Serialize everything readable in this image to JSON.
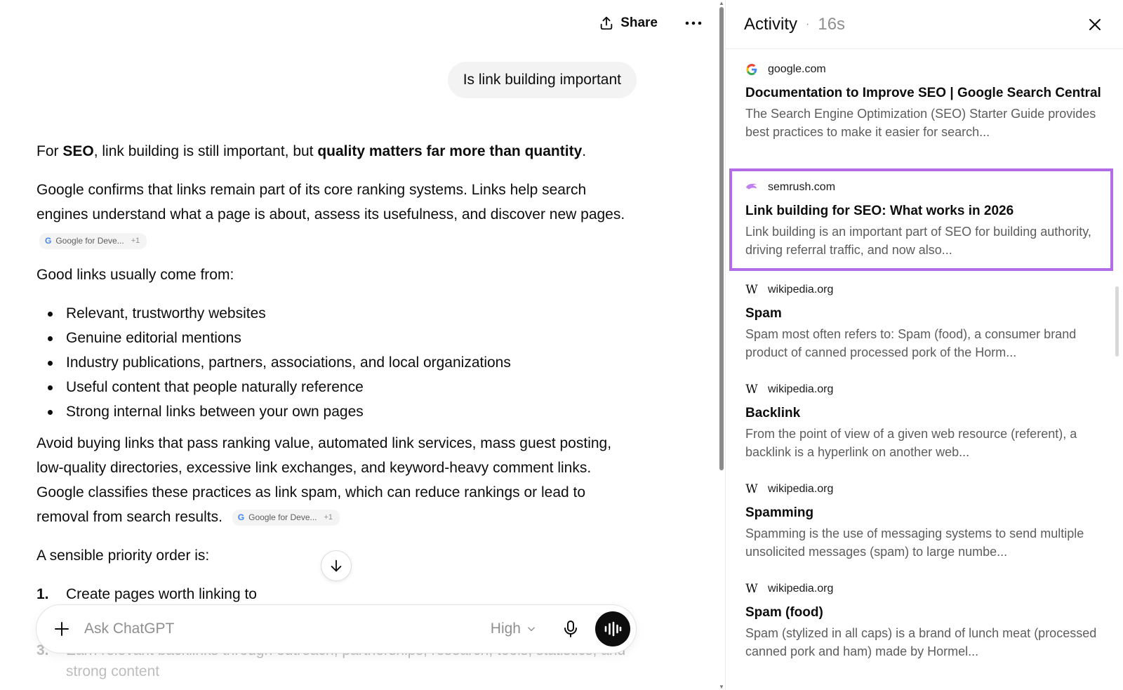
{
  "header": {
    "share_label": "Share",
    "more_icon": "more-horizontal-icon"
  },
  "user_message": "Is link building important",
  "answer": {
    "p1_pre": "For ",
    "p1_b1": "SEO",
    "p1_mid": ", link building is still important, but ",
    "p1_b2": "quality matters far more than quantity",
    "p1_post": ".",
    "p2": "Google confirms that links remain part of its core ranking systems. Links help search engines understand what a page is about, assess its usefulness, and discover new pages.",
    "citation_1": {
      "label": "Google for Deve...",
      "more": "+1"
    },
    "p3": "Good links usually come from:",
    "bullets": [
      "Relevant, trustworthy websites",
      "Genuine editorial mentions",
      "Industry publications, partners, associations, and local organizations",
      "Useful content that people naturally reference",
      "Strong internal links between your own pages"
    ],
    "p4": "Avoid buying links that pass ranking value, automated link services, mass guest posting, low-quality directories, excessive link exchanges, and keyword-heavy comment links. Google classifies these practices as link spam, which can reduce rankings or lead to removal from search results.",
    "citation_2": {
      "label": "Google for Deve...",
      "more": "+1"
    },
    "p5": "A sensible priority order is:",
    "steps": [
      {
        "num": "1.",
        "text": "Create pages worth linking to"
      },
      {
        "num": "3.",
        "text": "Earn relevant backlinks through outreach, partnerships, research, tools, statistics, and"
      },
      {
        "num": "",
        "text": "strong content"
      }
    ]
  },
  "composer": {
    "placeholder": "Ask ChatGPT",
    "model_label": "High"
  },
  "activity": {
    "title": "Activity",
    "elapsed": "16s",
    "sources": [
      {
        "domain": "google.com",
        "icon": "google-icon",
        "title": "Documentation to Improve SEO | Google Search Central",
        "snippet": "The Search Engine Optimization (SEO) Starter Guide provides best practices to make it easier for search..."
      },
      {
        "domain": "semrush.com",
        "icon": "semrush-icon",
        "title": "Link building for SEO: What works in 2026",
        "snippet": "Link building is an important part of SEO for building authority, driving referral traffic, and now also..."
      },
      {
        "domain": "wikipedia.org",
        "icon": "wikipedia-icon",
        "title": "Spam",
        "snippet": "Spam most often refers to: Spam (food), a consumer brand product of canned processed pork of the Horm..."
      },
      {
        "domain": "wikipedia.org",
        "icon": "wikipedia-icon",
        "title": "Backlink",
        "snippet": "From the point of view of a given web resource (referent), a backlink is a hyperlink on another web..."
      },
      {
        "domain": "wikipedia.org",
        "icon": "wikipedia-icon",
        "title": "Spamming",
        "snippet": "Spamming is the use of messaging systems to send multiple unsolicited messages (spam) to large numbe..."
      },
      {
        "domain": "wikipedia.org",
        "icon": "wikipedia-icon",
        "title": "Spam (food)",
        "snippet": "Spam (stylized in all caps) is a brand of lunch meat (processed canned pork and ham) made by Hormel..."
      }
    ]
  },
  "colors": {
    "highlight_border": "#b36be6",
    "google_blue": "#4285f4",
    "semrush_purple": "#c081f0"
  }
}
